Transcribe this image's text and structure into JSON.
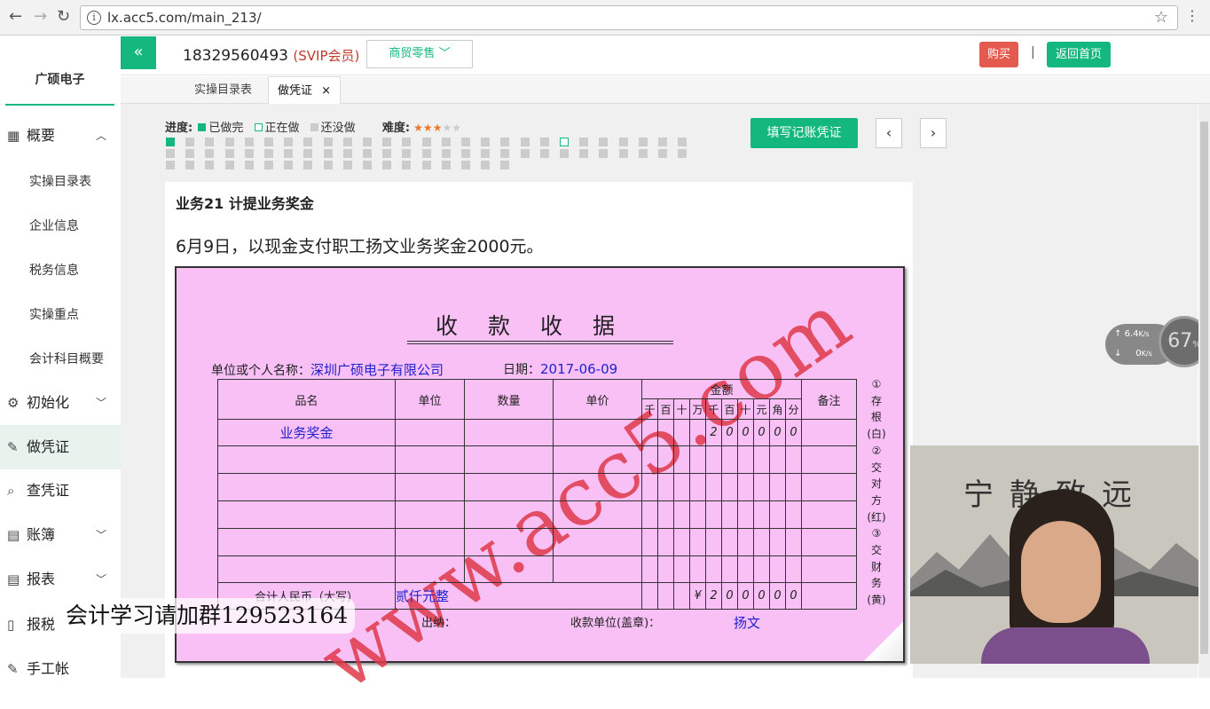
{
  "browser": {
    "url": "lx.acc5.com/main_213/"
  },
  "sidebar": {
    "brand": "广硕电子",
    "items": [
      {
        "label": "概要",
        "icon": "grid-icon"
      },
      {
        "label": "初始化",
        "icon": "gear-icon"
      },
      {
        "label": "做凭证",
        "icon": "pen-icon"
      },
      {
        "label": "查凭证",
        "icon": "search-icon"
      },
      {
        "label": "账簿",
        "icon": "book-icon"
      },
      {
        "label": "报表",
        "icon": "report-icon"
      },
      {
        "label": "报税",
        "icon": "file-icon"
      },
      {
        "label": "手工帐",
        "icon": "pen-icon"
      }
    ],
    "sub_items": [
      "实操目录表",
      "企业信息",
      "税务信息",
      "实操重点",
      "会计科目概要"
    ]
  },
  "header": {
    "phone": "18329560493",
    "vip": "(SVIP会员)",
    "dropdown": "商贸零售",
    "buy": "购买",
    "separator": "|",
    "home": "返回首页"
  },
  "tabs": [
    {
      "label": "实操目录表"
    },
    {
      "label": "做凭证"
    }
  ],
  "progress": {
    "label": "进度:",
    "done": "已做完",
    "doing": "正在做",
    "todo": "还没做",
    "difficulty_label": "难度:",
    "difficulty_stars": 3,
    "difficulty_max": 5,
    "current_index": 21
  },
  "actions": {
    "fill_voucher": "填写记账凭证"
  },
  "task": {
    "title": "业务21 计提业务奖金",
    "desc": "6月9日，以现金支付职工扬文业务奖金2000元。"
  },
  "receipt": {
    "title": "收款收据",
    "unit_label": "单位或个人名称：",
    "unit_value": "深圳广硕电子有限公司",
    "date_label": "日期：",
    "date_value": "2017-06-09",
    "headers": {
      "name": "品名",
      "unit": "单位",
      "qty": "数量",
      "price": "单价",
      "amount": "金额",
      "note": "备注"
    },
    "digits": [
      "千",
      "百",
      "十",
      "万",
      "千",
      "百",
      "十",
      "元",
      "角",
      "分"
    ],
    "item_name": "业务奖金",
    "item_amount_digits": [
      "",
      "",
      "",
      "",
      "2",
      "0",
      "0",
      "0",
      "0",
      "0"
    ],
    "total_label": "合计人民币（大写）",
    "total_words": "贰仟元整",
    "total_amount_digits": [
      "",
      "",
      "",
      "¥",
      "2",
      "0",
      "0",
      "0",
      "0",
      "0"
    ],
    "side_notes": [
      "①",
      "存",
      "根",
      "(白)",
      "②",
      "交",
      "对",
      "方",
      "(红)",
      "③",
      "交",
      "财",
      "务",
      "(黄)"
    ],
    "cashier_label": "出纳：",
    "payee_label": "收款单位(盖章)：",
    "payee_value": "扬文",
    "watermark": "www.acc5.com"
  },
  "network": {
    "up": "6.4",
    "down": "0",
    "unit": "K/s",
    "percent": "67",
    "percent_sign": "%"
  },
  "video": {
    "calligraphy": "宁静致远"
  },
  "caption": "会计学习请加群129523164"
}
